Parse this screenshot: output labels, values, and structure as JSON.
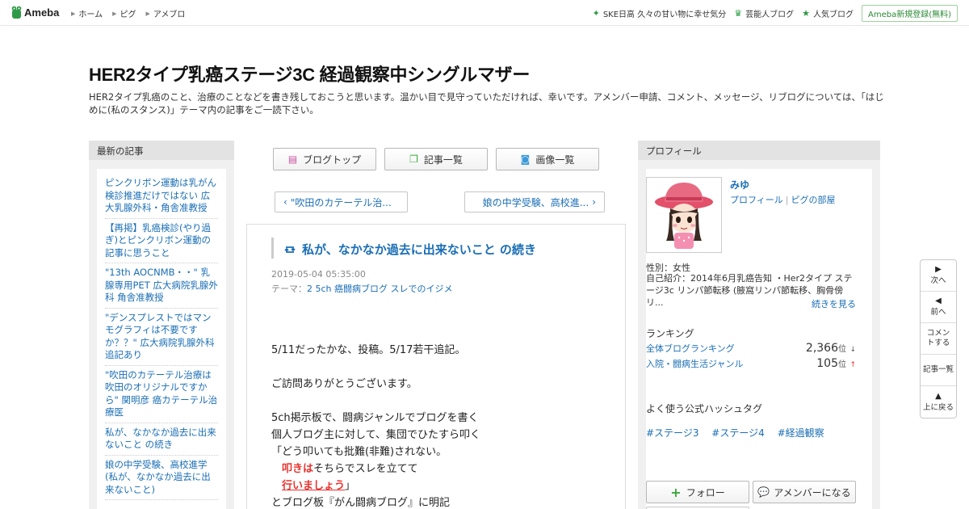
{
  "header": {
    "logo_text": "Ameba",
    "nav": [
      "ホーム",
      "ピグ",
      "アメブロ"
    ],
    "right_links": [
      {
        "icon": "sparkle-icon",
        "label": "SKE日高 久々の甘い物に幸せ気分"
      },
      {
        "icon": "crown-icon",
        "label": "芸能人ブログ"
      },
      {
        "icon": "star-icon",
        "label": "人気ブログ"
      }
    ],
    "register_label": "Ameba新規登録(無料)"
  },
  "blog": {
    "title": "HER2タイプ乳癌ステージ3C 経過観察中シングルマザー",
    "description": "HER2タイプ乳癌のこと、治療のことなどを書き残しておこうと思います。温かい目で見守っていただければ、幸いです。アメンバー申請、コメント、メッセージ、リブログについては、「はじめに(私のスタンス)」テーマ内の記事をご一読下さい。"
  },
  "left_sidebar": {
    "heading": "最新の記事",
    "items": [
      "ピンクリボン運動は乳がん検診推進だけではない 広大乳腺外科・角舎准教授",
      "【再掲】乳癌検診(やり過ぎ)とピンクリボン運動の記事に思うこと",
      "\"13th AOCNMB・・\" 乳腺専用PET 広大病院乳腺外科 角舎准教授",
      "\"デンスプレストではマンモグラフィは不要ですか？？\" 広大病院乳腺外科 追記あり",
      "\"吹田のカテーテル治療は吹田のオリジナルですから\" 関明彦 癌カテーテル治療医",
      "私が、なかなか過去に出来ないこと の続き",
      "娘の中学受験、高校進学(私が、なかなか過去に出来ないこと)"
    ]
  },
  "center": {
    "buttons": [
      {
        "icon": "document-icon",
        "label": "ブログトップ"
      },
      {
        "icon": "copy-icon",
        "label": "記事一覧"
      },
      {
        "icon": "camera-icon",
        "label": "画像一覧"
      }
    ],
    "prev_label": "\"吹田のカテーテル治...",
    "next_label": "娘の中学受験、高校進..."
  },
  "article": {
    "title": "私が、なかなか過去に出来ないこと の続き",
    "date": "2019-05-04 05:35:00",
    "theme_prefix": "テーマ：",
    "theme": "2 5ch 癌闘病ブログ スレでのイジメ",
    "lines": {
      "l1": "5/11だったかな、投稿。5/17若干追記。",
      "l2": "ご訪問ありがとうございます。",
      "l3": "5ch掲示板で、闘病ジャンルでブログを書く",
      "l4": "個人ブログ主に対して、集団でひたすら叩く",
      "l5": "「どう叩いても批難(非難)されない。",
      "l6_red": "叩きは",
      "l6_rest": "そちらでスレを立てて",
      "l7_red": "行いましょう",
      "l7_rest": "」",
      "l8": "とブログ板『がん闘病ブログ』に明記"
    }
  },
  "profile": {
    "heading": "プロフィール",
    "name": "みゆ",
    "link_profile": "プロフィール",
    "link_sep": "|",
    "link_pig": "ピグの部屋",
    "gender": "性別：女性",
    "intro": "自己紹介：2014年6月乳癌告知 ・Her2タイプ ステージ3c リンパ節転移 (腋窩リンパ節転移、胸骨傍リ...",
    "more": "続きを見る",
    "ranking_heading": "ランキング",
    "rankings": [
      {
        "label": "全体ブログランキング",
        "value": "2,366",
        "unit": "位",
        "trend": "↓"
      },
      {
        "label": "入院・闘病生活ジャンル",
        "value": "105",
        "unit": "位",
        "trend": "↑"
      }
    ],
    "hashtag_heading": "よく使う公式ハッシュタグ",
    "hashtags": [
      "#ステージ3",
      "#ステージ4",
      "#経過観察"
    ],
    "follow_label": "フォロー",
    "member_label": "アメンバーになる"
  },
  "sidenav": [
    {
      "icon": "triangle-right-icon",
      "label": "次へ"
    },
    {
      "icon": "triangle-left-icon",
      "label": "前へ"
    },
    {
      "icon": "",
      "label": "コメントする"
    },
    {
      "icon": "",
      "label": "記事一覧"
    },
    {
      "icon": "triangle-up-icon",
      "label": "上に戻る"
    }
  ],
  "colors": {
    "link": "#1a6eb5",
    "accent_green": "#2e9a47",
    "emphasis_red": "#e8322e"
  }
}
